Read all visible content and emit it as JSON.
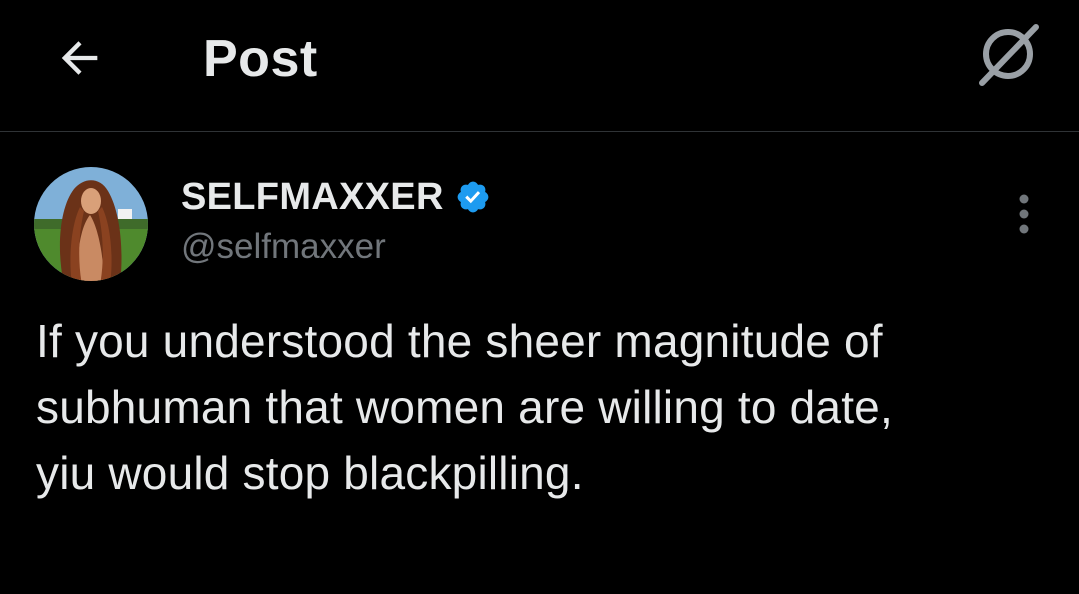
{
  "header": {
    "title": "Post",
    "back_icon": "arrow-left-icon",
    "grok_icon": "grok-icon"
  },
  "post": {
    "author": {
      "display_name": "SELFMAXXER",
      "handle": "@selfmaxxer",
      "verified": true,
      "verified_color": "#1d9bf0"
    },
    "more_icon": "more-vertical-icon",
    "text_lines": [
      "If you understood the sheer magnitude of",
      "subhuman that women are willing to date,",
      "yiu would stop blackpilling."
    ]
  },
  "colors": {
    "background": "#000000",
    "text_primary": "#e7e9ea",
    "text_secondary": "#71767b",
    "divider": "#2f3336",
    "accent": "#1d9bf0"
  }
}
